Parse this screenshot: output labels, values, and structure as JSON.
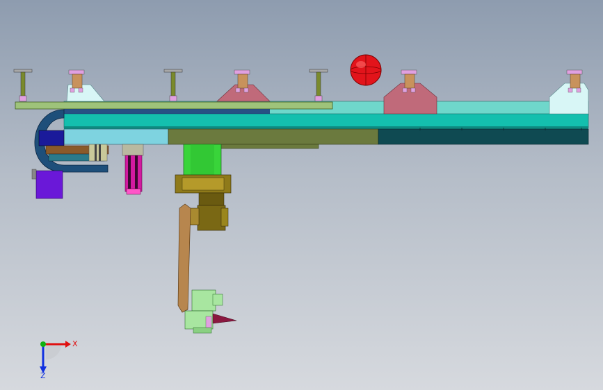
{
  "viewport": {
    "background_top": "#8e9caf",
    "background_bottom": "#d6d9de"
  },
  "colors": {
    "base_plate": "#9ec37a",
    "beam_cyan": "#14bfae",
    "beam_top": "#6fd7cb",
    "beam_lower_left": "#7ed3e0",
    "beam_lower_mid": "#6b7a3e",
    "beam_lower_right": "#0f4a52",
    "cable_chain": "#1e4f7a",
    "pink_bracket": "#c06a7a",
    "light_bracket": "#d8f6f6",
    "clamp_pink": "#e0a0e0",
    "clamp_tan": "#c8925c",
    "post_olive": "#7a8a2c",
    "motor_green": "#39d43a",
    "gearbox_olive": "#8f7a1a",
    "arm_tan": "#b7864e",
    "gripper_green": "#a8e6a0",
    "purple_block": "#6a18d8",
    "magenta_cylinder": "#d21aa0",
    "red_sphere": "#e2141b",
    "axis_x": "#e01010",
    "axis_y": "#10b010",
    "axis_z": "#1030e0"
  },
  "triad": {
    "x_label": "X",
    "z_label": "Z"
  }
}
